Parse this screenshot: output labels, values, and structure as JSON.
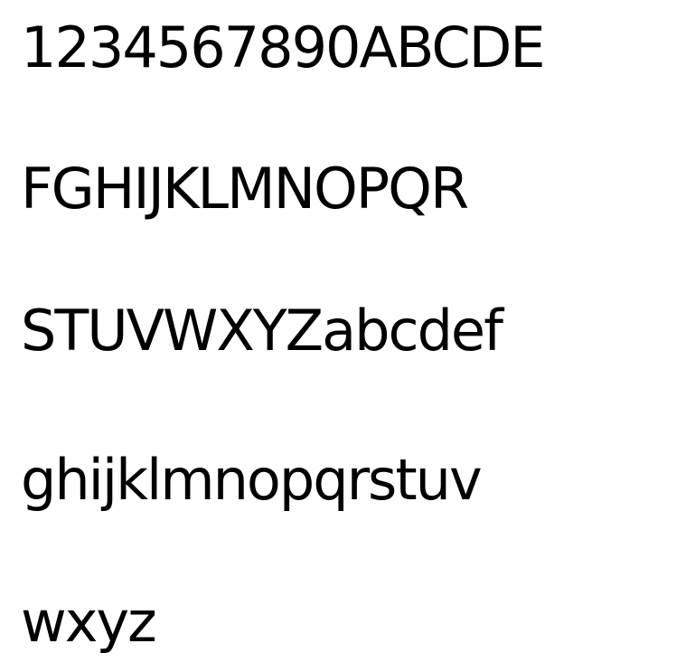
{
  "sample": {
    "lines": [
      "1234567890ABCDE",
      "FGHIJKLMNOPQR",
      "STUVWXYZabcdef",
      "ghijklmnopqrstuv",
      "wxyz"
    ]
  },
  "colors": {
    "background": "#ffffff",
    "text": "#000000"
  }
}
